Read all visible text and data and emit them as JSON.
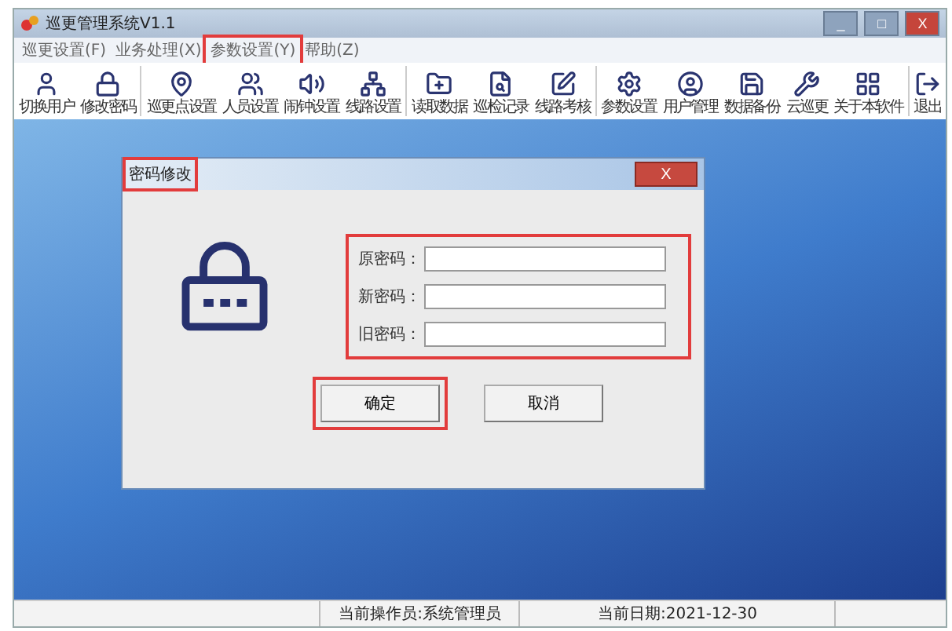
{
  "window": {
    "title": "巡更管理系统V1.1",
    "controls": [
      "_",
      "□",
      "X"
    ]
  },
  "menu": [
    {
      "label": "巡更设置(F)",
      "highlighted": false
    },
    {
      "label": "业务处理(X)",
      "highlighted": false
    },
    {
      "label": "参数设置(Y)",
      "highlighted": true
    },
    {
      "label": "帮助(Z)",
      "highlighted": false
    }
  ],
  "toolbar_groups": [
    [
      "切换用户",
      "修改密码"
    ],
    [
      "巡更点设置",
      "人员设置",
      "闹钟设置",
      "线路设置"
    ],
    [
      "读取数据",
      "巡检记录",
      "线路考核"
    ],
    [
      "参数设置",
      "用户管理",
      "数据备份",
      "云巡更",
      "关于本软件"
    ],
    [
      "退出"
    ]
  ],
  "dialog": {
    "title": "密码修改",
    "title_highlighted": true,
    "close": "X",
    "fields_highlighted": true,
    "fields": [
      {
        "label": "原密码："
      },
      {
        "label": "新密码："
      },
      {
        "label": "旧密码："
      }
    ],
    "buttons": [
      {
        "label": "确定",
        "highlighted": true
      },
      {
        "label": "取消",
        "highlighted": false
      }
    ]
  },
  "status_bar": {
    "operator": "当前操作员:系统管理员",
    "date": "当前日期:2021-12-30"
  }
}
